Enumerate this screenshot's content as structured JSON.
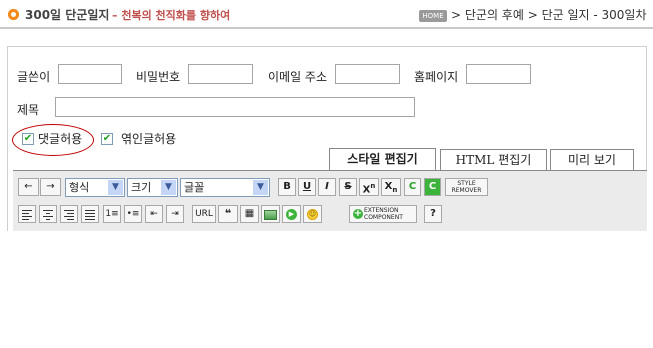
{
  "header": {
    "title": "300일 단군일지",
    "subtitle": "– 천복의 천직화를 향하여",
    "home_label": "HOME",
    "breadcrumb": "> 단군의 후예 > 단군 일지 - 300일차"
  },
  "form": {
    "author_label": "글쓴이",
    "author_value": "",
    "password_label": "비밀번호",
    "password_value": "",
    "email_label": "이메일 주소",
    "email_value": "",
    "homepage_label": "홈페이지",
    "homepage_value": "",
    "subject_label": "제목",
    "subject_value": "",
    "allow_comments_label": "댓글허용",
    "allow_comments_checked": true,
    "allow_trackback_label": "엮인글허용",
    "allow_trackback_checked": true
  },
  "tabs": [
    {
      "label": "스타일 편집기",
      "active": true
    },
    {
      "label": "HTML 편집기",
      "active": false
    },
    {
      "label": "미리 보기",
      "active": false
    }
  ],
  "toolbar": {
    "format_select": "형식",
    "size_select": "크기",
    "font_select": "글꼴",
    "bold": "B",
    "underline": "U",
    "italic": "I",
    "strike": "S",
    "superscript": "X",
    "subscript": "X",
    "text_color": "C",
    "bg_color": "C",
    "style_remover": "STYLE REMOVER",
    "url": "URL",
    "quote": "❝",
    "extension": "EXTENSION COMPONENT",
    "help": "?"
  },
  "colors": {
    "accent": "#f08a1c",
    "subtitle": "#c0504d",
    "highlight_circle": "#c00000",
    "green_button": "#3cb43c"
  }
}
